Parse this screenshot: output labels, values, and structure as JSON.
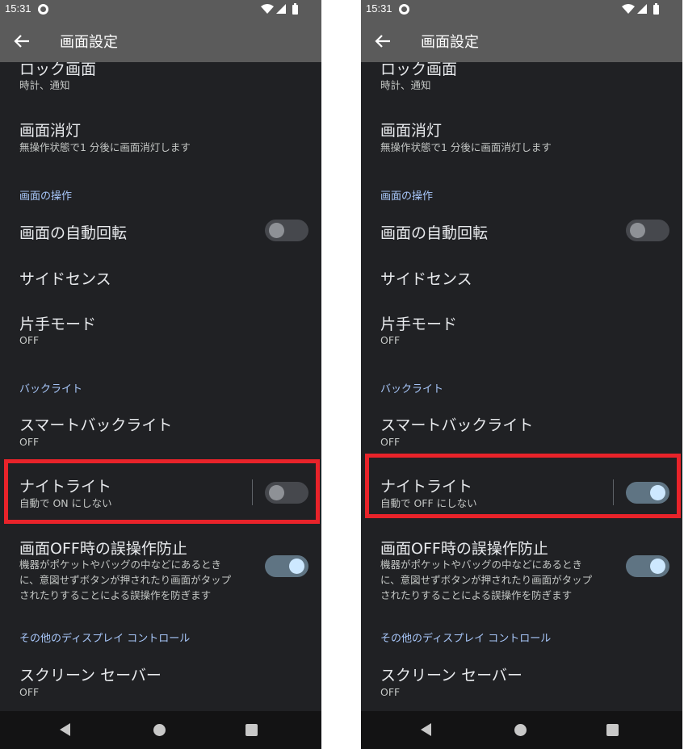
{
  "screens": [
    {
      "status_time": "15:31",
      "title": "画面設定",
      "items": {
        "lock_title": "ロック画面",
        "lock_sub": "時計、通知",
        "sleep_title": "画面消灯",
        "sleep_sub": "無操作状態で1 分後に画面消灯します",
        "cat_operation": "画面の操作",
        "autorotate_title": "画面の自動回転",
        "autorotate_on": false,
        "sidesense_title": "サイドセンス",
        "onehand_title": "片手モード",
        "onehand_sub": "OFF",
        "cat_backlight": "バックライト",
        "smartbacklight_title": "スマートバックライト",
        "smartbacklight_sub": "OFF",
        "nightlight_title": "ナイトライト",
        "nightlight_sub": "自動で ON にしない",
        "nightlight_on": false,
        "pocket_title": "画面OFF時の誤操作防止",
        "pocket_sub": [
          "機器がポケットやバッグの中などにあるとき",
          "に、意図せずボタンが押されたり画面がタップ",
          "されたりすることによる誤操作を防ぎます"
        ],
        "pocket_on": true,
        "cat_other": "その他のディスプレイ コントロール",
        "screensaver_title": "スクリーン セーバー",
        "screensaver_sub": "OFF"
      }
    },
    {
      "status_time": "15:31",
      "title": "画面設定",
      "items": {
        "lock_title": "ロック画面",
        "lock_sub": "時計、通知",
        "sleep_title": "画面消灯",
        "sleep_sub": "無操作状態で1 分後に画面消灯します",
        "cat_operation": "画面の操作",
        "autorotate_title": "画面の自動回転",
        "autorotate_on": false,
        "sidesense_title": "サイドセンス",
        "onehand_title": "片手モード",
        "onehand_sub": "OFF",
        "cat_backlight": "バックライト",
        "smartbacklight_title": "スマートバックライト",
        "smartbacklight_sub": "OFF",
        "nightlight_title": "ナイトライト",
        "nightlight_sub": "自動で OFF にしない",
        "nightlight_on": true,
        "pocket_title": "画面OFF時の誤操作防止",
        "pocket_sub": [
          "機器がポケットやバッグの中などにあるとき",
          "に、意図せずボタンが押されたり画面がタップ",
          "されたりすることによる誤操作を防ぎます"
        ],
        "pocket_on": true,
        "cat_other": "その他のディスプレイ コントロール",
        "screensaver_title": "スクリーン セーバー",
        "screensaver_sub": "OFF"
      }
    }
  ],
  "colors": {
    "highlight": "#e8232a",
    "background": "#202124",
    "toolbar": "#5b5b5b",
    "category_text": "#a8c7fa",
    "toggle_on_track": "#5f7483",
    "toggle_on_knob": "#cde8ff"
  },
  "icons": {
    "back": "arrow-left-icon",
    "wifi": "wifi-icon",
    "signal": "signal-icon",
    "battery": "battery-icon",
    "nav_back": "nav-back-icon",
    "nav_home": "nav-home-icon",
    "nav_recents": "nav-recents-icon"
  }
}
